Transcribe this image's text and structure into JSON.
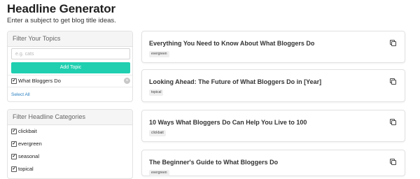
{
  "page": {
    "title": "Headline Generator",
    "subtitle": "Enter a subject to get blog title ideas."
  },
  "topics_panel": {
    "header": "Filter Your Topics",
    "input_placeholder": "e.g. cats",
    "input_value": "",
    "add_button": "Add Topic",
    "topics": [
      {
        "label": "What Bloggers Do",
        "checked": true
      }
    ],
    "select_all": "Select All",
    "remove_icon": "x-circle-icon",
    "checkbox_mark": "✔"
  },
  "categories_panel": {
    "header": "Filter Headline Categories",
    "items": [
      {
        "label": "clickbait",
        "checked": true
      },
      {
        "label": "evergreen",
        "checked": true
      },
      {
        "label": "seasonal",
        "checked": true
      },
      {
        "label": "topical",
        "checked": true
      }
    ]
  },
  "headlines": [
    {
      "title": "Everything You Need to Know About What Bloggers Do",
      "tag": "evergreen"
    },
    {
      "title": "Looking Ahead: The Future of What Bloggers Do in [Year]",
      "tag": "topical"
    },
    {
      "title": "10 Ways What Bloggers Do Can Help You Live to 100",
      "tag": "clickbait"
    },
    {
      "title": "The Beginner's Guide to What Bloggers Do",
      "tag": "evergreen"
    }
  ],
  "icons": {
    "copy": "copy-icon"
  },
  "colors": {
    "accent": "#1fcfb0",
    "link": "#2a7fc1"
  }
}
